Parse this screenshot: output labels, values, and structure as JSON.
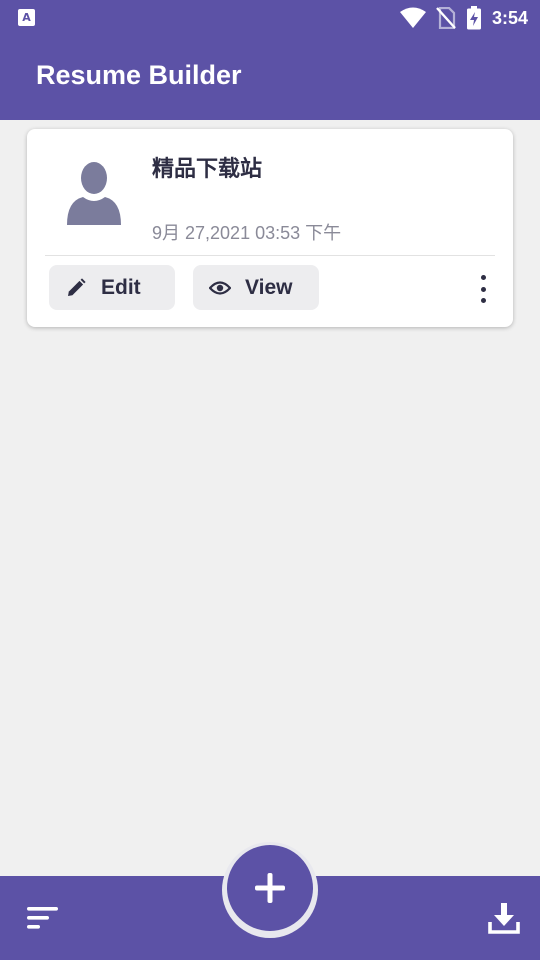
{
  "status_bar": {
    "time": "3:54",
    "left_icon_letter": "A",
    "icons": [
      "wifi-icon",
      "no-sim-icon",
      "battery-charging-icon"
    ]
  },
  "app_bar": {
    "title": "Resume Builder"
  },
  "resumes": [
    {
      "name": "精品下载站",
      "date": "9月 27,2021 03:53 下午",
      "edit_label": "Edit",
      "view_label": "View"
    }
  ],
  "bottom_bar": {
    "icons": [
      "sort-icon",
      "add-icon",
      "download-icon"
    ]
  },
  "colors": {
    "primary": "#5c52a6",
    "background": "#f0f0f0",
    "card": "#ffffff",
    "button_bg": "#ededef",
    "text_dark": "#2e2e44",
    "text_muted": "#8a8a98"
  }
}
